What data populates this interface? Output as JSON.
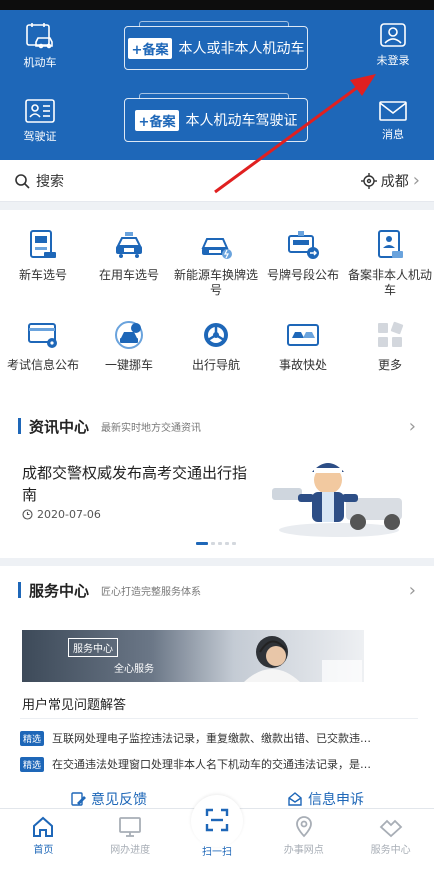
{
  "header": {
    "left_top_label": "机动车",
    "left_bottom_label": "驾驶证",
    "card1": {
      "tag": "+备案",
      "text": "本人或非本人机动车"
    },
    "card2": {
      "tag": "+备案",
      "text": "本人机动车驾驶证"
    },
    "right_top_label": "未登录",
    "right_bottom_label": "消息"
  },
  "search": {
    "placeholder": "搜索",
    "city": "成都"
  },
  "grid": [
    {
      "label": "新车选号"
    },
    {
      "label": "在用车选号"
    },
    {
      "label": "新能源车换牌选号"
    },
    {
      "label": "号牌号段公布"
    },
    {
      "label": "备案非本人机动车"
    },
    {
      "label": "考试信息公布"
    },
    {
      "label": "一键挪车"
    },
    {
      "label": "出行导航"
    },
    {
      "label": "事故快处"
    },
    {
      "label": "更多"
    }
  ],
  "news": {
    "title": "资讯中心",
    "subtitle": "最新实时地方交通资讯",
    "headline": "成都交警权威发布高考交通出行指南",
    "date": "2020-07-06"
  },
  "service": {
    "title": "服务中心",
    "subtitle": "匠心打造完整服务体系",
    "banner_tag": "服务中心",
    "banner_text": "全心服务",
    "faq_title": "用户常见问题解答",
    "pick_label": "精选",
    "faqs": [
      "互联网处理电子监控违法记录，重复缴款、缴款出错、已交款违…",
      "在交通违法处理窗口处理非本人名下机动车的交通违法记录，是…"
    ],
    "feedback": "意见反馈",
    "complaint": "信息申诉"
  },
  "tabs": [
    {
      "label": "首页"
    },
    {
      "label": "网办进度"
    },
    {
      "label": "扫一扫"
    },
    {
      "label": "办事网点"
    },
    {
      "label": "服务中心"
    }
  ],
  "colors": {
    "primary": "#1e67b8",
    "annotation_arrow": "#e02020"
  }
}
